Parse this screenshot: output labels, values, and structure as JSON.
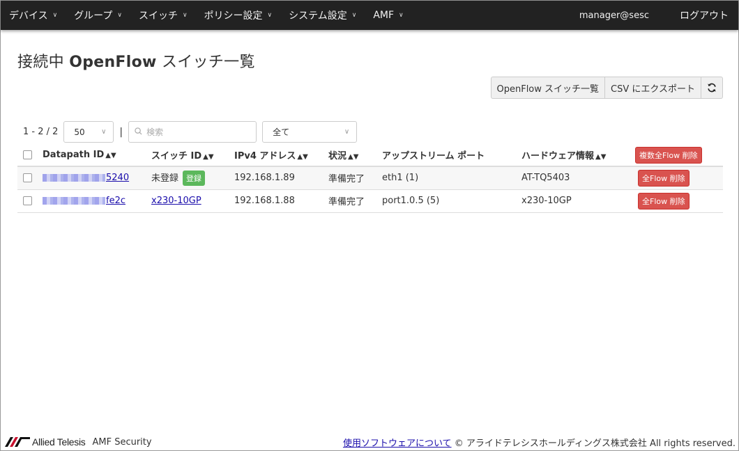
{
  "nav": {
    "items": [
      {
        "label": "デバイス"
      },
      {
        "label": "グループ"
      },
      {
        "label": "スイッチ"
      },
      {
        "label": "ポリシー設定"
      },
      {
        "label": "システム設定"
      },
      {
        "label": "AMF"
      }
    ],
    "user": "manager@sesc",
    "logout": "ログアウト"
  },
  "page": {
    "title_prefix": "接続中 ",
    "title_bold": "OpenFlow",
    "title_suffix": " スイッチ一覧"
  },
  "actions": {
    "list_label": "OpenFlow スイッチ一覧",
    "export_label": "CSV にエクスポート",
    "refresh_icon": "refresh-icon"
  },
  "toolbar": {
    "count": "1 - 2 / 2",
    "page_size": "50",
    "search_placeholder": "検索",
    "filter_value": "全て"
  },
  "table": {
    "headers": {
      "datapath": "Datapath ID",
      "switch": "スイッチ ID",
      "ipv4": "IPv4 アドレス",
      "status": "状況",
      "upstream": "アップストリーム ポート",
      "hardware": "ハードウェア情報",
      "bulk_delete": "複数全Flow 削除"
    },
    "rows": [
      {
        "datapath_suffix": "5240",
        "switch": "未登録",
        "register": "登録",
        "ipv4": "192.168.1.89",
        "status": "準備完了",
        "upstream": "eth1 (1)",
        "hardware": "AT-TQ5403",
        "delete": "全Flow 削除"
      },
      {
        "datapath_suffix": "fe2c",
        "switch": "x230-10GP",
        "ipv4": "192.168.1.88",
        "status": "準備完了",
        "upstream": "port1.0.5 (5)",
        "hardware": "x230-10GP",
        "delete": "全Flow 削除"
      }
    ]
  },
  "footer": {
    "brand": "Allied Telesis",
    "product": "AMF Security",
    "software_link": "使用ソフトウェアについて",
    "copyright": " © アライドテレシスホールディングス株式会社 All rights reserved."
  },
  "colors": {
    "navbar": "#222222",
    "danger": "#d9534f",
    "success": "#5cb85c",
    "link": "#1a0dab"
  }
}
